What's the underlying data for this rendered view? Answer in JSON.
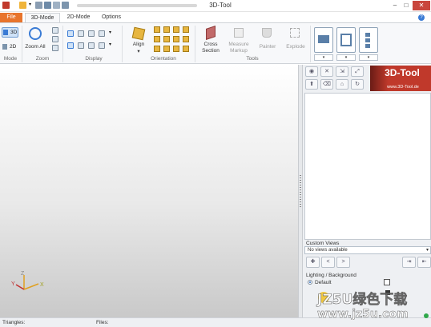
{
  "window": {
    "title": "3D-Tool"
  },
  "tabs": [
    "File",
    "3D-Mode",
    "2D-Mode",
    "Options"
  ],
  "ribbon": {
    "mode": {
      "btn_3d": "3D",
      "btn_2d": "2D",
      "group": "Mode"
    },
    "zoom": {
      "zoom_all": "Zoom All",
      "group": "Zoom"
    },
    "display": {
      "group": "Display"
    },
    "orientation": {
      "align": "Align",
      "group": "Orientation"
    },
    "tools": {
      "cross_section": "Cross Section",
      "measure_markup": "Measure Markup",
      "painter": "Painter",
      "explode": "Explode",
      "group": "Tools"
    }
  },
  "panel": {
    "logo_text": "3D-Tool",
    "logo_url": "www.3D-Tool.de",
    "custom_views_label": "Custom Views",
    "views_combo": "No views available",
    "nav_prev": "<",
    "nav_next": ">",
    "lighting_label": "Lighting / Background",
    "default_radio": "Default"
  },
  "viewport": {
    "axes": [
      "Y",
      "Z",
      "X"
    ]
  },
  "status": {
    "triangles": "Triangles:",
    "files": "Files:"
  },
  "watermark": {
    "text": "JZ5U绿色下载",
    "url": "www.jz5u.com"
  },
  "colors": {
    "file_tab": "#e8742c",
    "logo": "#c0392b",
    "accent": "#2c6bbf"
  }
}
